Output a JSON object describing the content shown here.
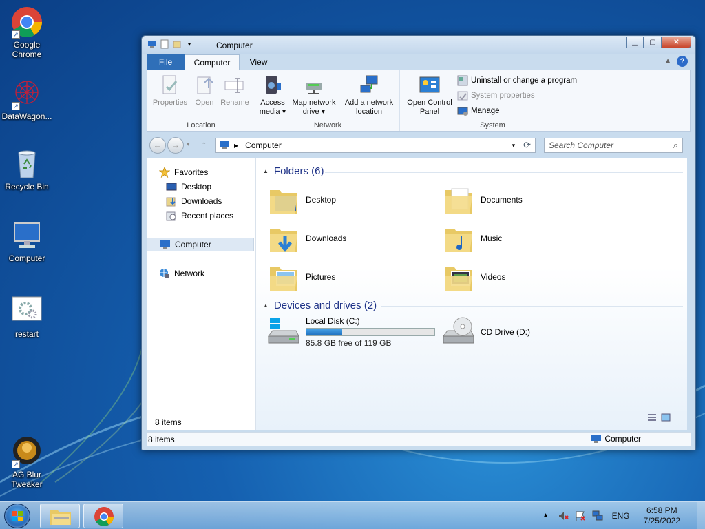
{
  "desktop": {
    "icons": [
      {
        "label": "Google Chrome"
      },
      {
        "label": "DataWagon..."
      },
      {
        "label": "Recycle Bin"
      },
      {
        "label": "Computer"
      },
      {
        "label": "restart"
      },
      {
        "label": "AG Blur Tweaker"
      }
    ]
  },
  "window": {
    "title": "Computer",
    "tabs": {
      "file": "File",
      "computer": "Computer",
      "view": "View"
    },
    "help": "?",
    "ribbon": {
      "location": {
        "label": "Location",
        "properties": "Properties",
        "open": "Open",
        "rename": "Rename"
      },
      "network": {
        "label": "Network",
        "access_media_1": "Access",
        "access_media_2": "media ▾",
        "map_drive_1": "Map network",
        "map_drive_2": "drive ▾",
        "add_location_1": "Add a network",
        "add_location_2": "location"
      },
      "system": {
        "label": "System",
        "control_panel_1": "Open Control",
        "control_panel_2": "Panel",
        "uninstall": "Uninstall or change a program",
        "system_properties": "System properties",
        "manage": "Manage"
      }
    },
    "address": {
      "crumb": "Computer"
    },
    "search": {
      "placeholder": "Search Computer"
    },
    "nav": {
      "favorites": "Favorites",
      "desktop": "Desktop",
      "downloads": "Downloads",
      "recent": "Recent places",
      "computer": "Computer",
      "network": "Network"
    },
    "folders_header": "Folders (6)",
    "folders": [
      "Desktop",
      "Documents",
      "Downloads",
      "Music",
      "Pictures",
      "Videos"
    ],
    "devices_header": "Devices and drives (2)",
    "drive_c": {
      "name": "Local Disk (C:)",
      "free": "85.8 GB free of 119 GB",
      "used_fraction": 0.28
    },
    "drive_d": {
      "name": "CD Drive (D:)"
    },
    "item_count": "8 items",
    "status": {
      "left": "8 items",
      "right": "Computer"
    }
  },
  "taskbar": {
    "lang": "ENG",
    "time": "6:58 PM",
    "date": "7/25/2022"
  }
}
